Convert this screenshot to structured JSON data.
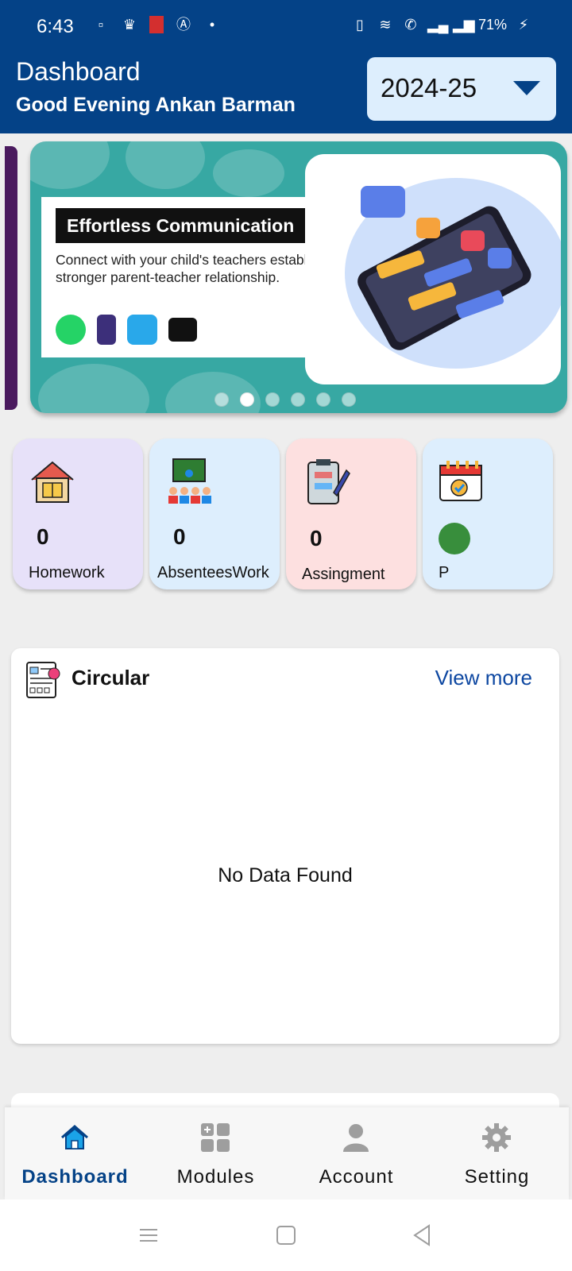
{
  "status_bar": {
    "time": "6:43",
    "battery": "71%",
    "left_icons": [
      "notification-icon",
      "flashlight-icon",
      "red-app-icon",
      "a-icon",
      "dot-icon"
    ],
    "right_icons": [
      "vibrate-icon",
      "wifi-icon",
      "wifi-call-icon",
      "signal-icon",
      "roaming-signal-icon",
      "battery-charging-icon"
    ]
  },
  "header": {
    "title": "Dashboard",
    "greeting": "Good Evening Ankan  Barman",
    "year": "2024-25"
  },
  "banner": {
    "heading": "Effortless Communication",
    "description": "Connect with your child's teachers establishing a stronger parent-teacher relationship.",
    "apps": [
      "whatsapp-icon",
      "phone-icon",
      "mail-icon",
      "chat-icon"
    ],
    "slides": 6,
    "active_slide": 2
  },
  "tiles": [
    {
      "label": "Homework",
      "count": "0",
      "icon": "homework-house-icon",
      "color": "#e7e1f9"
    },
    {
      "label": "AbsenteesWork",
      "count": "0",
      "icon": "classroom-icon",
      "color": "#ddeefd"
    },
    {
      "label": "Assingment",
      "count": "0",
      "icon": "clipboard-icon",
      "color": "#fde0e0"
    },
    {
      "label": "P",
      "count": "",
      "icon": "calendar-check-icon",
      "color": "#ddeefd",
      "status_color": "#388e3c"
    }
  ],
  "circular": {
    "title": "Circular",
    "view_more": "View more",
    "empty_text": "No Data Found"
  },
  "bottom_nav": [
    {
      "label": "Dashboard",
      "icon": "home-icon",
      "active": true
    },
    {
      "label": "Modules",
      "icon": "modules-icon",
      "active": false
    },
    {
      "label": "Account",
      "icon": "account-icon",
      "active": false
    },
    {
      "label": "Setting",
      "icon": "gear-icon",
      "active": false
    }
  ],
  "colors": {
    "primary": "#044287",
    "accent_active": "#1aa3e8",
    "status_green": "#388e3c"
  }
}
